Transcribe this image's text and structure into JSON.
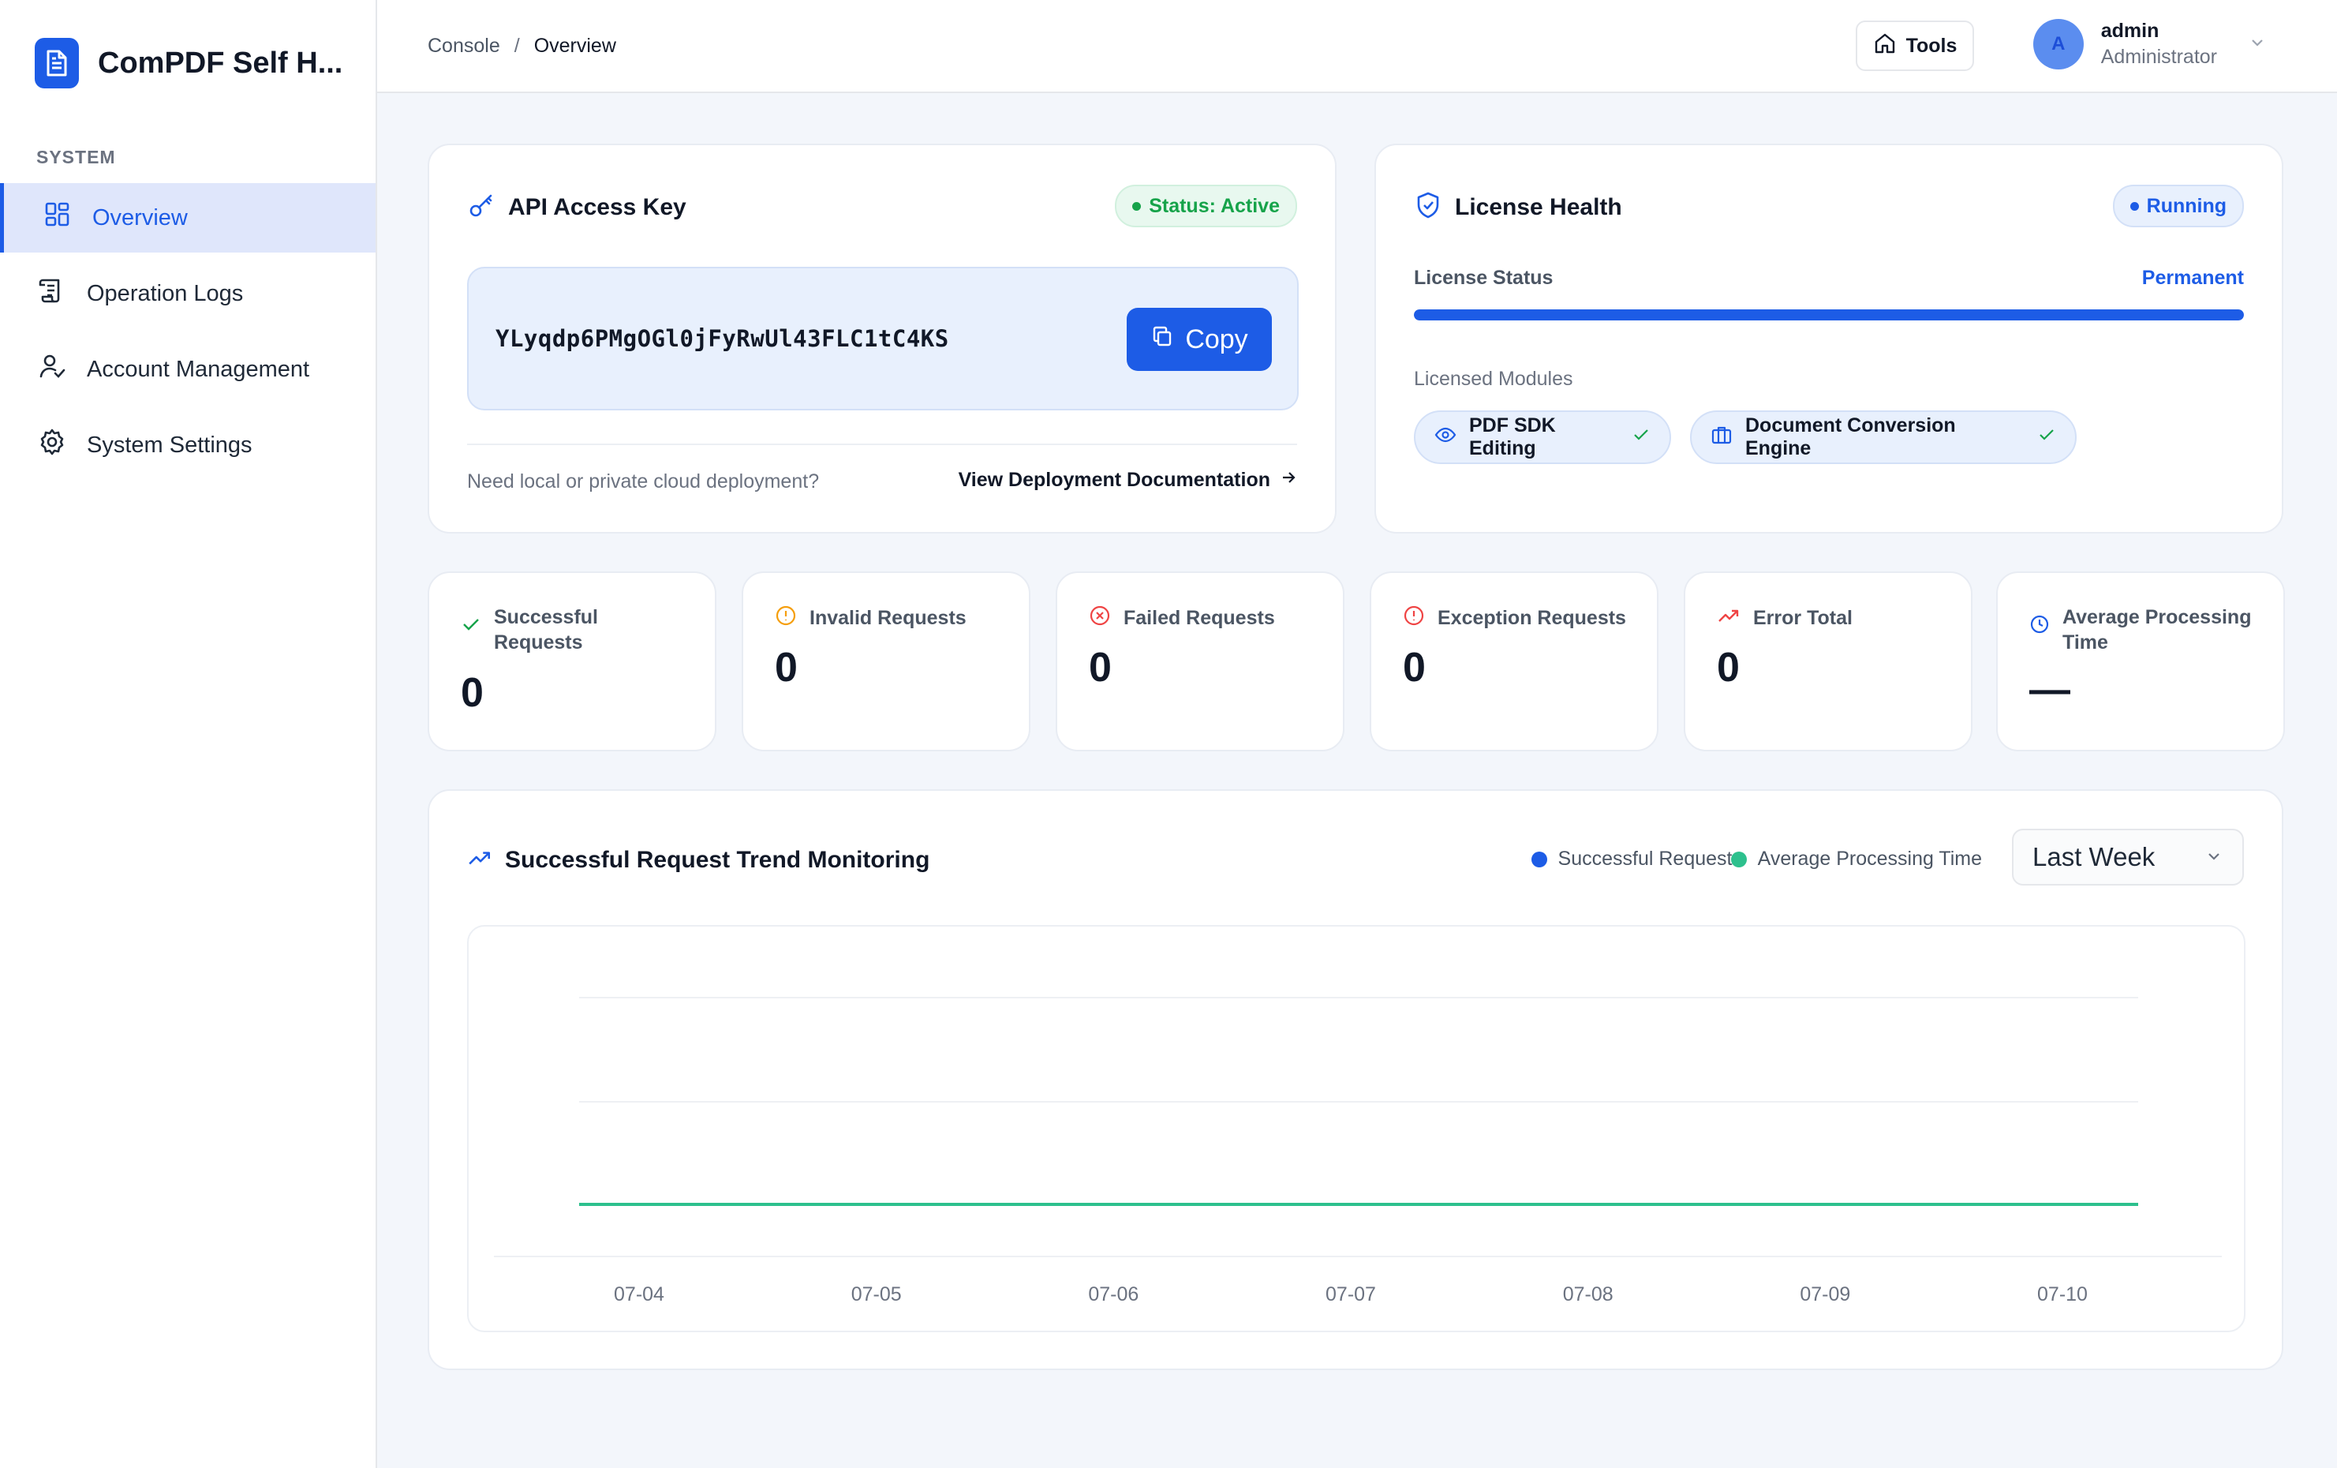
{
  "app": {
    "name": "ComPDF Self H..."
  },
  "sidebar": {
    "section": "SYSTEM",
    "items": [
      {
        "label": "Overview",
        "icon": "grid-icon",
        "active": true
      },
      {
        "label": "Operation Logs",
        "icon": "scroll-icon",
        "active": false
      },
      {
        "label": "Account Management",
        "icon": "user-check-icon",
        "active": false
      },
      {
        "label": "System Settings",
        "icon": "gear-icon",
        "active": false
      }
    ]
  },
  "header": {
    "breadcrumb": [
      "Console",
      "Overview"
    ],
    "breadcrumb_sep": "/",
    "tools_label": "Tools",
    "user": {
      "initial": "A",
      "name": "admin",
      "role": "Administrator"
    }
  },
  "api_key": {
    "title": "API Access Key",
    "status": "Status: Active",
    "key": "YLyqdp6PMgOGl0jFyRwUl43FLC1tC4KS",
    "copy_label": "Copy",
    "footer_text": "Need local or private cloud deployment?",
    "doc_link": "View Deployment Documentation"
  },
  "license": {
    "title": "License Health",
    "status_badge": "Running",
    "status_label": "License Status",
    "status_value": "Permanent",
    "progress": 1.0,
    "modules_label": "Licensed Modules",
    "modules": [
      "PDF SDK Editing",
      "Document Conversion Engine"
    ]
  },
  "stats": [
    {
      "label": "Successful Requests",
      "value": "0",
      "icon": "check-icon",
      "color": "#16a34a"
    },
    {
      "label": "Invalid Requests",
      "value": "0",
      "icon": "alert-circle-icon",
      "color": "#f59e0b"
    },
    {
      "label": "Failed Requests",
      "value": "0",
      "icon": "x-circle-icon",
      "color": "#ef4444"
    },
    {
      "label": "Exception Requests",
      "value": "0",
      "icon": "alert-circle-icon",
      "color": "#ef4444"
    },
    {
      "label": "Error Total",
      "value": "0",
      "icon": "trend-up-icon",
      "color": "#ef4444"
    },
    {
      "label": "Average Processing Time",
      "value": "—",
      "icon": "clock-icon",
      "color": "#1d5ce6"
    }
  ],
  "trend": {
    "title": "Successful Request Trend Monitoring",
    "legend": [
      {
        "name": "Successful Requests",
        "color": "#1d5ce6"
      },
      {
        "name": "Average Processing Time",
        "color": "#2dc08d"
      }
    ],
    "range": "Last Week"
  },
  "chart_data": {
    "type": "line",
    "x": [
      "07-04",
      "07-05",
      "07-06",
      "07-07",
      "07-08",
      "07-09",
      "07-10"
    ],
    "series": [
      {
        "name": "Successful Requests",
        "values": [
          0,
          0,
          0,
          0,
          0,
          0,
          0
        ],
        "color": "#1d5ce6"
      },
      {
        "name": "Average Processing Time",
        "values": [
          0,
          0,
          0,
          0,
          0,
          0,
          0
        ],
        "color": "#2dc08d"
      }
    ],
    "grid": true,
    "y_axis_labels": false
  }
}
